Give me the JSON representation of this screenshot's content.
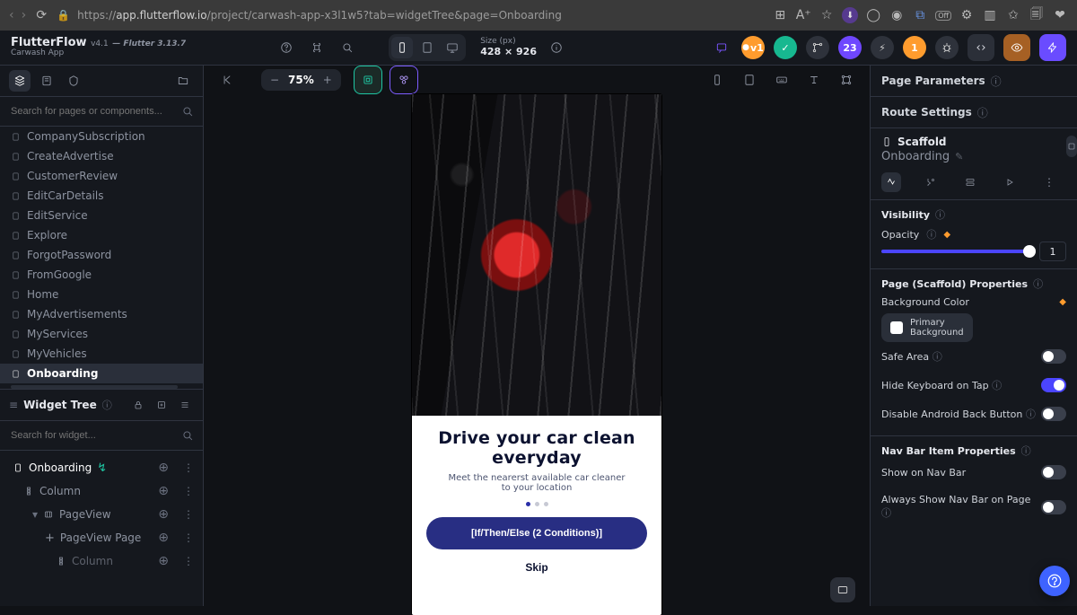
{
  "browser": {
    "url_prefix": "https://",
    "url_host": "app.flutterflow.io",
    "url_path": "/project/carwash-app-x3l1w5?tab=widgetTree&page=Onboarding"
  },
  "brand": {
    "name": "FlutterFlow",
    "version": "v4.1",
    "flutter": "— Flutter 3.13.7",
    "project": "Carwash App"
  },
  "topbar": {
    "size_label": "Size (px)",
    "size_value": "428 × 926",
    "v_label": "v1",
    "badge_23": "23",
    "badge_1": "1"
  },
  "left": {
    "search_pages_placeholder": "Search for pages or components...",
    "pages": [
      "CompanySubscription",
      "CreateAdvertise",
      "CustomerReview",
      "EditCarDetails",
      "EditService",
      "Explore",
      "ForgotPassword",
      "FromGoogle",
      "Home",
      "MyAdvertisements",
      "MyServices",
      "MyVehicles",
      "Onboarding"
    ],
    "active_page_index": 12,
    "widget_tree_label": "Widget Tree",
    "search_widget_placeholder": "Search for widget...",
    "tree": [
      {
        "label": "Onboarding",
        "indent": 0,
        "icon": "page",
        "action": true
      },
      {
        "label": "Column",
        "indent": 1,
        "icon": "column"
      },
      {
        "label": "PageView",
        "indent": 2,
        "icon": "pageview",
        "chev": true
      },
      {
        "label": "PageView Page",
        "indent": 3,
        "icon": "plus"
      },
      {
        "label": "Column",
        "indent": 4,
        "icon": "column",
        "dim": true
      }
    ]
  },
  "center": {
    "zoom": "75%",
    "card_title_l1": "Drive your car clean",
    "card_title_l2": "everyday",
    "card_sub_l1": "Meet the  nearerst available car cleaner",
    "card_sub_l2": "to your location",
    "btn_primary": "[If/Then/Else (2 Conditions)]",
    "btn_skip": "Skip"
  },
  "right": {
    "page_params": "Page Parameters",
    "route_settings": "Route Settings",
    "scaffold_label": "Scaffold",
    "page_name": "Onboarding",
    "visibility": "Visibility",
    "opacity": "Opacity",
    "opacity_value": "1",
    "scaffold_props": "Page (Scaffold) Properties",
    "bg_color": "Background Color",
    "bg_color_value_l1": "Primary",
    "bg_color_value_l2": "Background",
    "safe_area": "Safe Area",
    "hide_kb": "Hide Keyboard on Tap",
    "disable_back": "Disable Android Back Button",
    "navbar_props": "Nav Bar Item Properties",
    "show_navbar": "Show on Nav Bar",
    "always_show": "Always Show Nav Bar on Page"
  }
}
